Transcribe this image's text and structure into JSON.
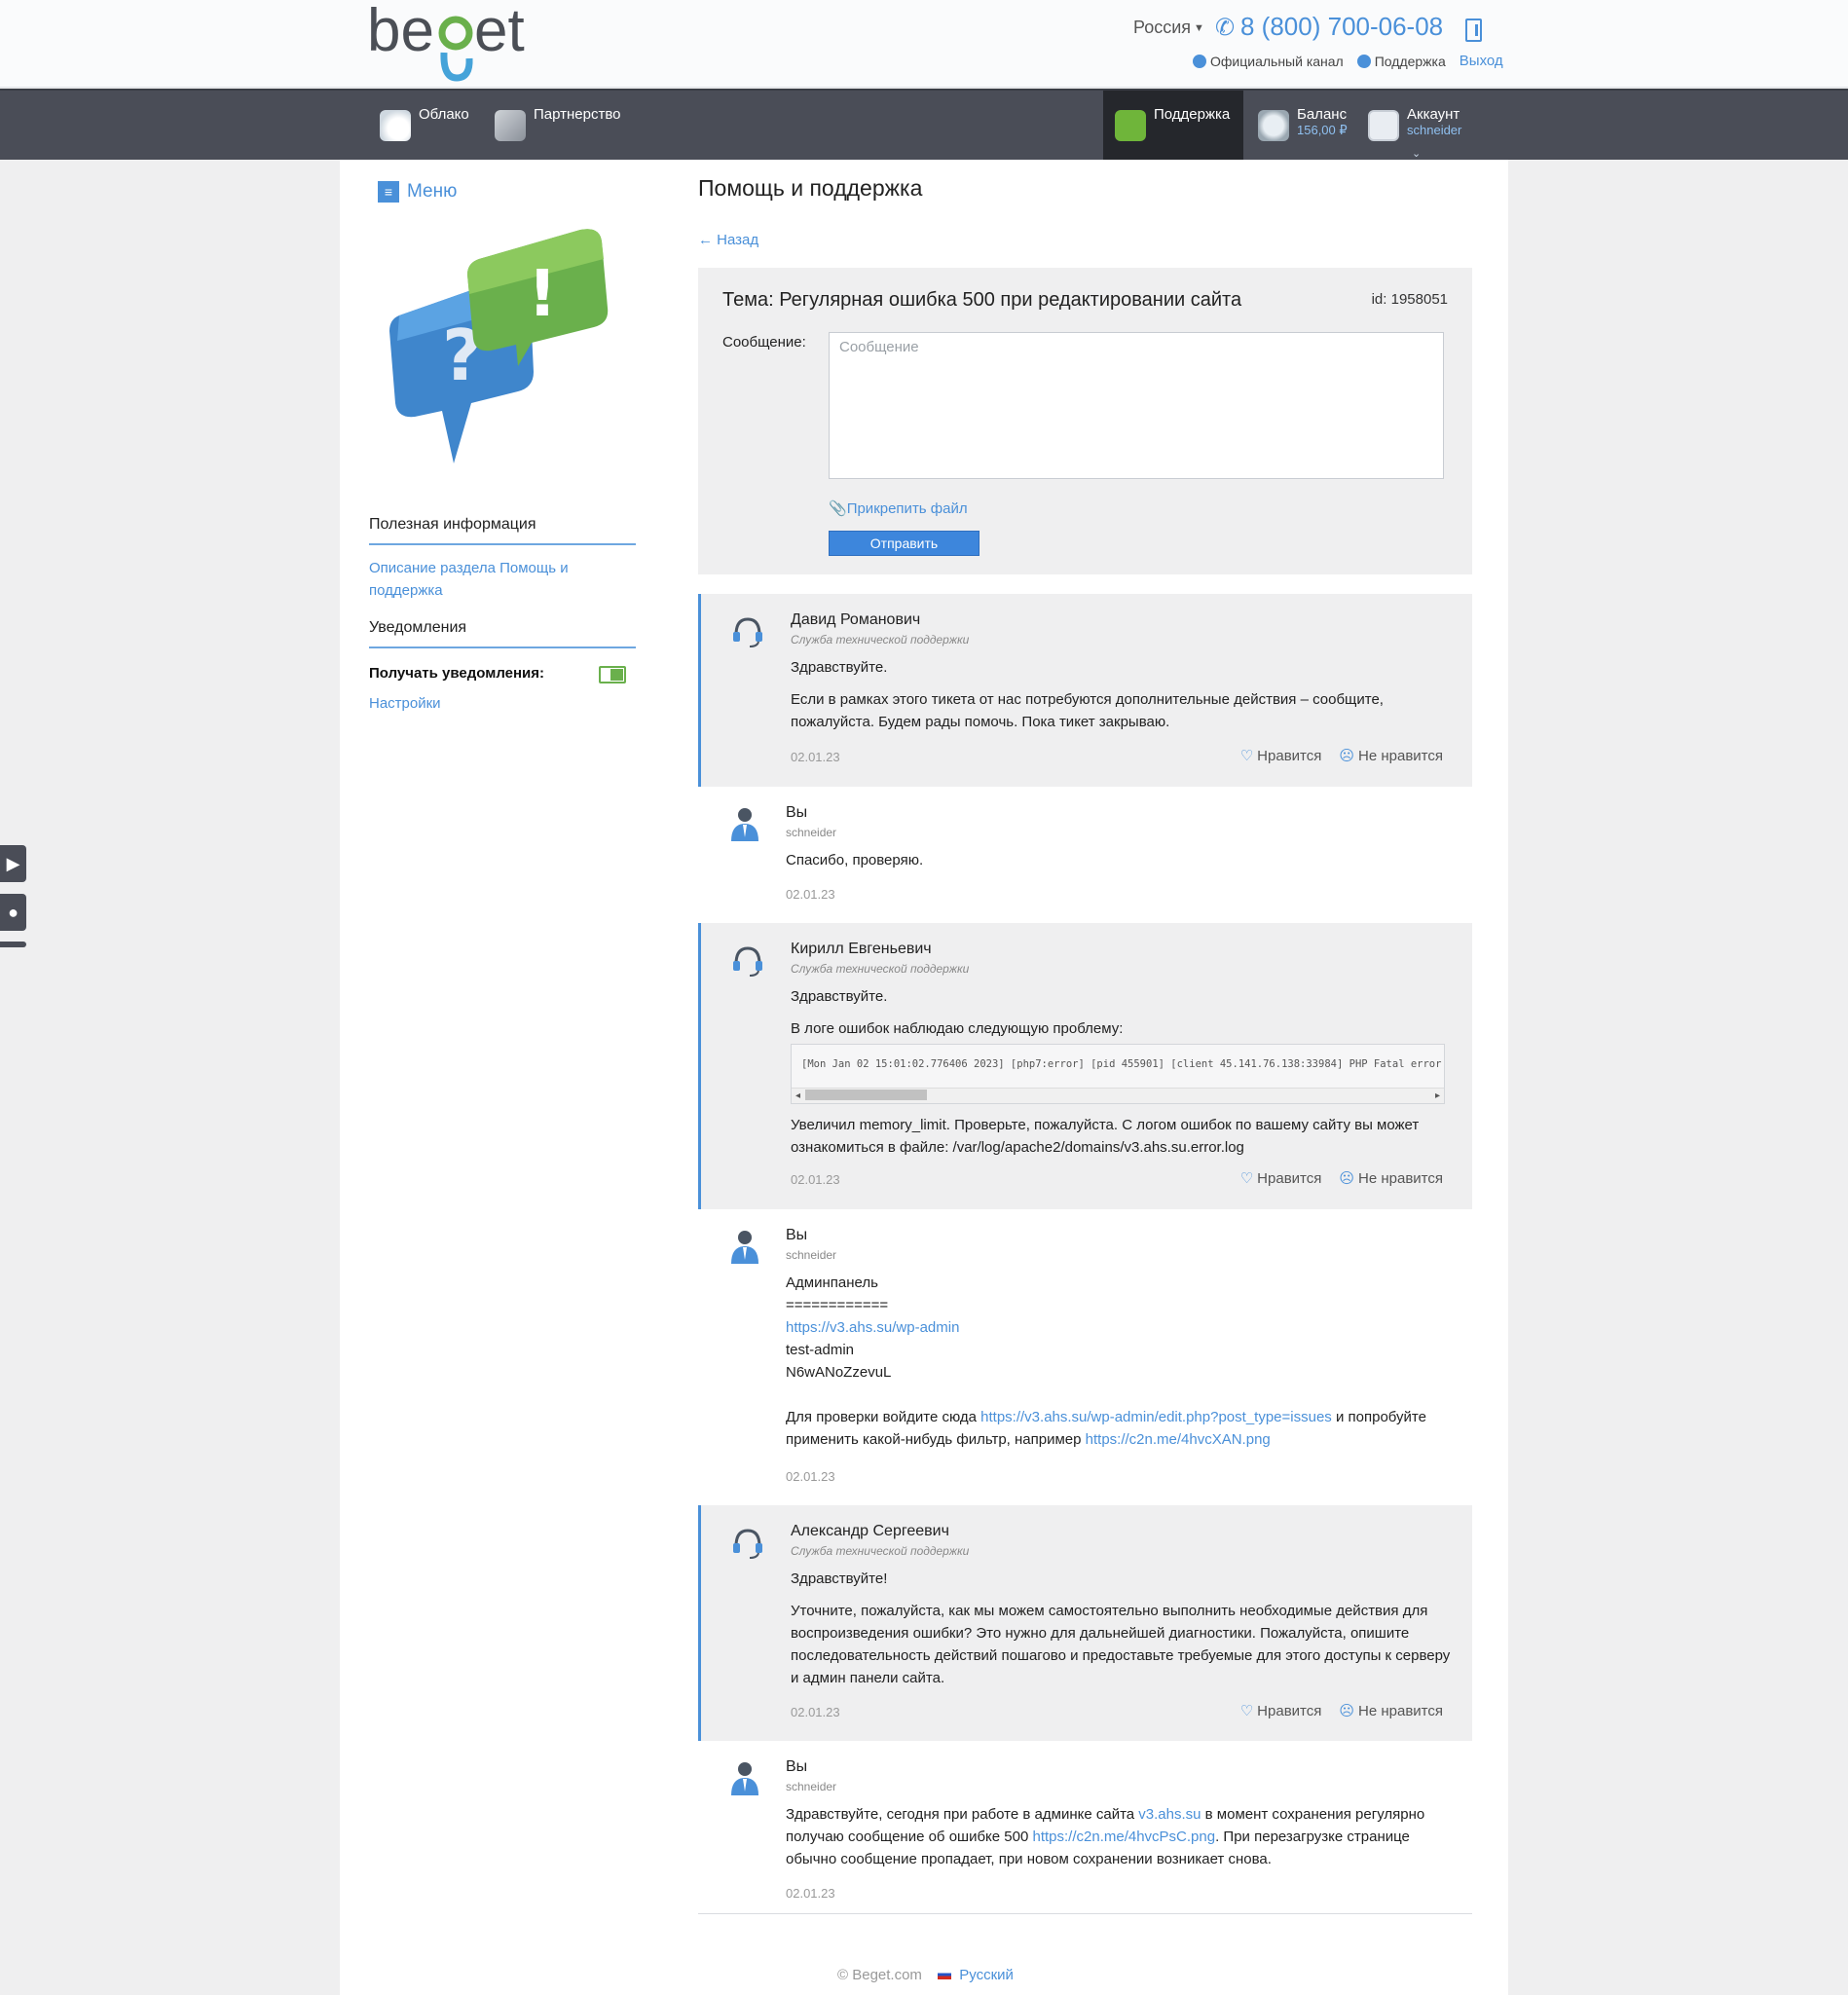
{
  "header": {
    "logo": "beget",
    "region": "Россия",
    "phone": "8 (800) 700-06-08",
    "official_channel": "Официальный канал",
    "support_link": "Поддержка",
    "logout": "Выход"
  },
  "nav": {
    "cloud": "Облако",
    "partnership": "Партнерство",
    "support": "Поддержка",
    "balance_label": "Баланс",
    "balance_value": "156,00 ₽",
    "account_label": "Аккаунт",
    "account_value": "schneider"
  },
  "sidebar": {
    "menu": "Меню",
    "useful_info_title": "Полезная информация",
    "useful_info_link": "Описание раздела Помощь и поддержка",
    "notifications_title": "Уведомления",
    "receive_notifications": "Получать уведомления:",
    "settings": "Настройки"
  },
  "main": {
    "title": "Помощь и поддержка",
    "back": "← Назад",
    "topic": "Тема: Регулярная ошибка 500 при редактировании сайта",
    "ticket_id": "id: 1958051",
    "message_label": "Сообщение:",
    "message_placeholder": "Сообщение",
    "attach": "Прикрепить файл",
    "send": "Отправить"
  },
  "labels": {
    "like": "Нравится",
    "dislike": "Не нравится"
  },
  "messages": [
    {
      "author": "Давид Романович",
      "role": "Служба технической поддержки",
      "p1": "Здравствуйте.",
      "p2": "Если в рамках этого тикета от нас потребуются дополнительные действия – сообщите, пожалуйста. Будем рады помочь. Пока тикет закрываю.",
      "date": "02.01.23"
    },
    {
      "author": "Вы",
      "role": "schneider",
      "p1": "Спасибо, проверяю.",
      "date": "02.01.23"
    },
    {
      "author": "Кирилл Евгеньевич",
      "role": "Служба технической поддержки",
      "p1": "Здравствуйте.",
      "p2": "В логе ошибок наблюдаю следующую проблему:",
      "code": "[Mon Jan 02 15:01:02.776406 2023] [php7:error] [pid 455901] [client 45.141.76.138:33984] PHP Fatal error",
      "p3": "Увеличил memory_limit. Проверьте, пожалуйста. С логом ошибок по вашему сайту вы может ознакомиться в файле: /var/log/apache2/domains/v3.ahs.su.error.log",
      "date": "02.01.23"
    },
    {
      "author": "Вы",
      "role": "schneider",
      "l1": "Админпанель",
      "l2": "============",
      "l3": "https://v3.ahs.su/wp-admin",
      "l4": "test-admin",
      "l5": "N6wANoZzevuL",
      "p_pre": "Для проверки войдите сюда ",
      "link1": "https://v3.ahs.su/wp-admin/edit.php?post_type=issues",
      "p_mid": " и попробуйте применить какой-нибудь фильтр, например ",
      "link2": "https://c2n.me/4hvcXAN.png",
      "date": "02.01.23"
    },
    {
      "author": "Александр Сергеевич",
      "role": "Служба технической поддержки",
      "p1": "Здравствуйте!",
      "p2": "Уточните, пожалуйста, как мы можем самостоятельно выполнить необходимые действия для воспроизведения ошибки? Это нужно для дальнейшей диагностики. Пожалуйста, опишите последовательность действий пошагово и предоставьте требуемые для этого доступы к серверу и админ панели сайта.",
      "date": "02.01.23"
    },
    {
      "author": "Вы",
      "role": "schneider",
      "p_pre": "Здравствуйте, сегодня при работе в админке сайта ",
      "link1": "v3.ahs.su",
      "p_mid": " в момент сохранения регулярно получаю сообщение об ошибке 500 ",
      "link2": "https://c2n.me/4hvcPsC.png",
      "p_post": ". При перезагрузке странице обычно сообщение пропадает, при новом сохранении возникает снова.",
      "date": "02.01.23"
    }
  ],
  "footer": {
    "copyright": "© Beget.com",
    "language": "Русский"
  },
  "colors": {
    "accent": "#4a90d9",
    "nav_bg": "#4a4d57",
    "brand_green": "#6ab04c"
  }
}
